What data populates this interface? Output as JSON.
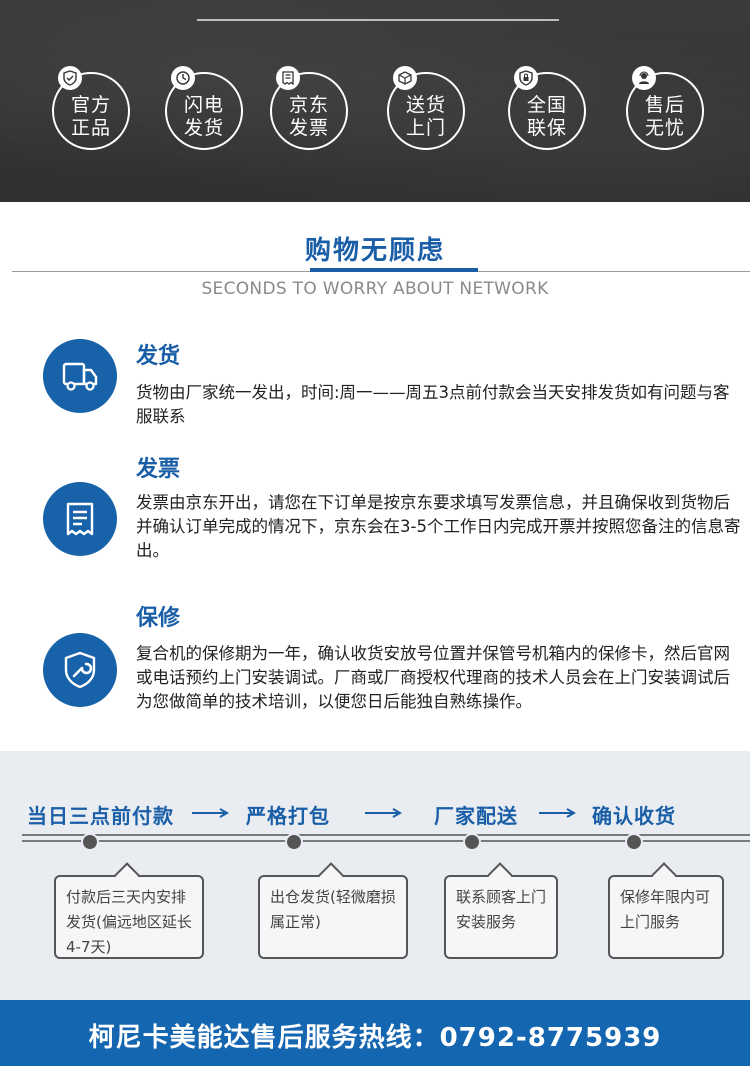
{
  "banner": {
    "badges": [
      {
        "line1": "官方",
        "line2": "正品",
        "icon": "shield-check-icon"
      },
      {
        "line1": "闪电",
        "line2": "发货",
        "icon": "clock-lightning-icon"
      },
      {
        "line1": "京东",
        "line2": "发票",
        "icon": "receipt-icon"
      },
      {
        "line1": "送货",
        "line2": "上门",
        "icon": "box-icon"
      },
      {
        "line1": "全国",
        "line2": "联保",
        "icon": "shield-lock-icon"
      },
      {
        "line1": "售后",
        "line2": "无忧",
        "icon": "headset-person-icon"
      }
    ]
  },
  "section": {
    "title": "购物无顾虑",
    "subtitle": "SECONDS TO WORRY ABOUT NETWORK"
  },
  "services": [
    {
      "heading": "发货",
      "icon": "truck-icon",
      "body": "货物由厂家统一发出，时间:周一——周五3点前付款会当天安排发货如有问题与客服联系"
    },
    {
      "heading": "发票",
      "icon": "invoice-icon",
      "body": "发票由京东开出，请您在下订单是按京东要求填写发票信息，并且确保收到货物后并确认订单完成的情况下，京东会在3-5个工作日内完成开票并按照您备注的信息寄出。"
    },
    {
      "heading": "保修",
      "icon": "wrench-shield-icon",
      "body": "复合机的保修期为一年，确认收货安放号位置并保管号机箱内的保修卡，然后官网或电话预约上门安装调试。厂商或厂商授权代理商的技术人员会在上门安装调试后为您做简单的技术培训，以便您日后能独自熟练操作。"
    }
  ],
  "process": {
    "steps": [
      {
        "label": "当日三点前付款",
        "note": "付款后三天内安排发货(偏远地区延长4-7天)"
      },
      {
        "label": "严格打包",
        "note": "出仓发货(轻微磨损属正常)"
      },
      {
        "label": "厂家配送",
        "note": "联系顾客上门安装服务"
      },
      {
        "label": "确认收货",
        "note": "保修年限内可上门服务"
      }
    ]
  },
  "footer": {
    "hotline": "柯尼卡美能达售后服务热线：0792-8775939"
  },
  "colors": {
    "accent": "#1a5ea8",
    "footer": "#1566b1",
    "banner": "#333333",
    "process_bg": "#e9edf2"
  }
}
